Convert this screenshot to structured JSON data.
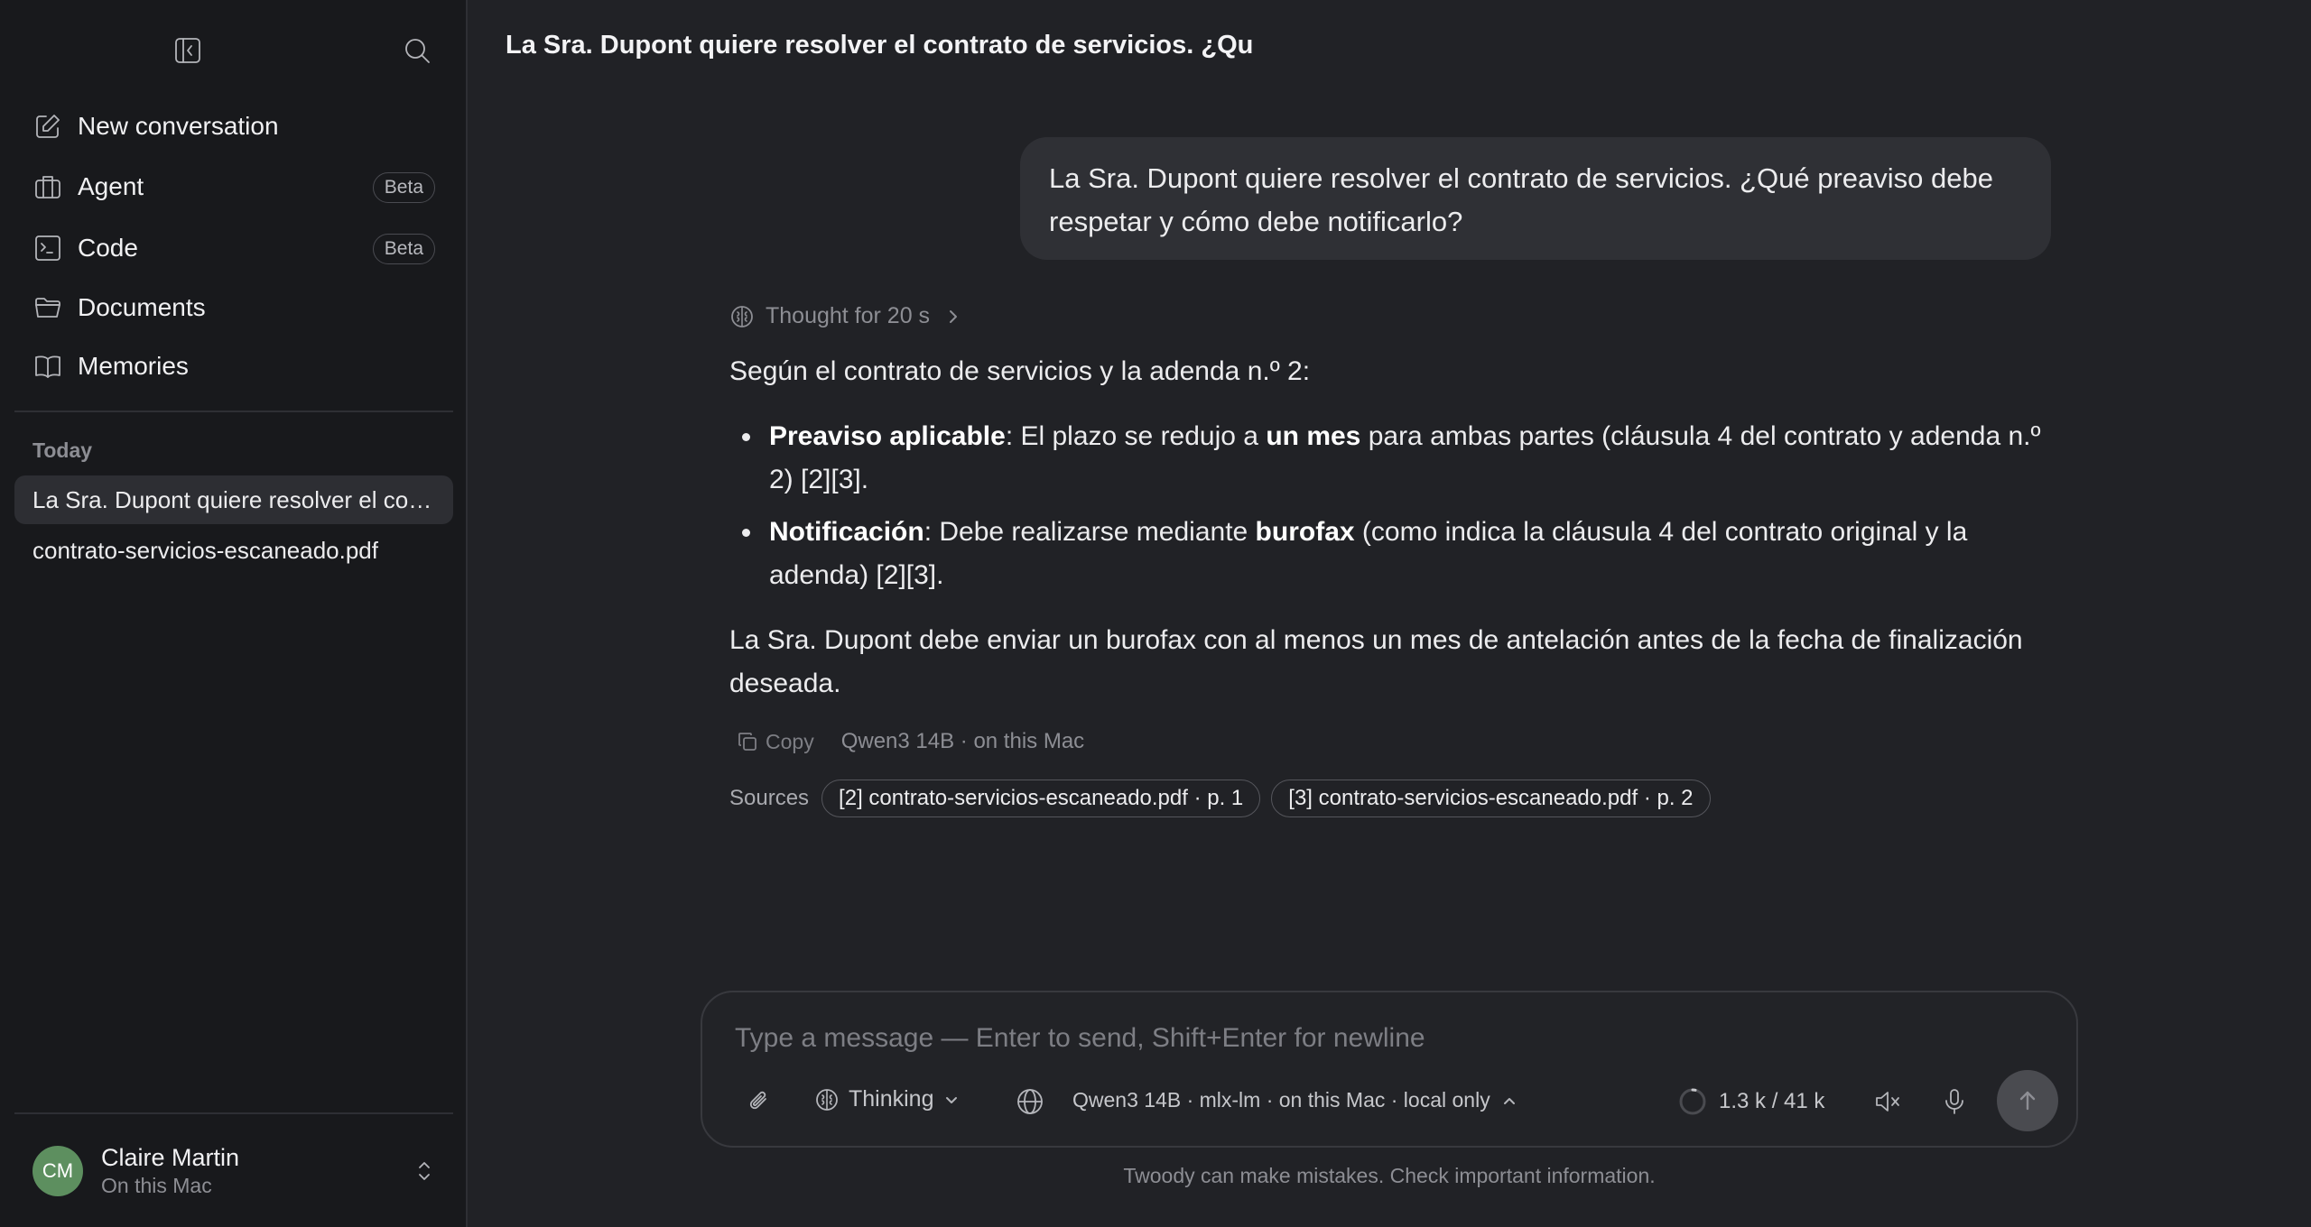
{
  "sidebar": {
    "nav": [
      {
        "label": "New conversation",
        "icon": "compose-icon"
      },
      {
        "label": "Agent",
        "icon": "briefcase-icon",
        "badge": "Beta"
      },
      {
        "label": "Code",
        "icon": "terminal-icon",
        "badge": "Beta"
      },
      {
        "label": "Documents",
        "icon": "folder-icon"
      },
      {
        "label": "Memories",
        "icon": "book-icon"
      }
    ],
    "section_today": "Today",
    "conversations": [
      {
        "title": "La Sra. Dupont quiere resolver el contrato de servicios. ¿Qué preaviso debe respetar y cómo debe notificarlo?",
        "active": true
      },
      {
        "title": "contrato-servicios-escaneado.pdf",
        "active": false
      }
    ],
    "user": {
      "initials": "CM",
      "name": "Claire Martin",
      "subtitle": "On this Mac"
    }
  },
  "main": {
    "title": "La Sra. Dupont quiere resolver el contrato de servicios. ¿Qu",
    "user_message": "La Sra. Dupont quiere resolver el contrato de servicios. ¿Qué preaviso debe respetar y cómo debe notificarlo?",
    "thought_label": "Thought for 20 s",
    "answer": {
      "intro": "Según el contrato de servicios y la adenda n.º 2:",
      "bullet1": {
        "b1": "Preaviso aplicable",
        "t1": ": El plazo se redujo a ",
        "b2": "un mes",
        "t2": " para ambas partes (cláusula 4 del contrato y adenda n.º 2) [2][3]."
      },
      "bullet2": {
        "b1": "Notificación",
        "t1": ": Debe realizarse mediante ",
        "b2": "burofax",
        "t2": " (como indica la cláusula 4 del contrato original y la adenda) [2][3]."
      },
      "conclusion": "La Sra. Dupont debe enviar un burofax con al menos un mes de antelación antes de la fecha de finalización deseada."
    },
    "copy_label": "Copy",
    "model_meta": "Qwen3 14B · on this Mac",
    "sources_label": "Sources",
    "sources": [
      "[2] contrato-servicios-escaneado.pdf · p. 1",
      "[3] contrato-servicios-escaneado.pdf · p. 2"
    ]
  },
  "composer": {
    "placeholder": "Type a message — Enter to send, Shift+Enter for newline",
    "thinking_label": "Thinking",
    "model_selector": "Qwen3 14B · mlx-lm · on this Mac · local only",
    "token_count": "1.3 k / 41 k",
    "disclaimer": "Twoody can make mistakes. Check important information."
  },
  "colors": {
    "background": "#212226",
    "sidebar": "#18191c",
    "bubble": "#2f3035",
    "avatar": "#5d8f5f",
    "send_button": "#4a4b50"
  }
}
